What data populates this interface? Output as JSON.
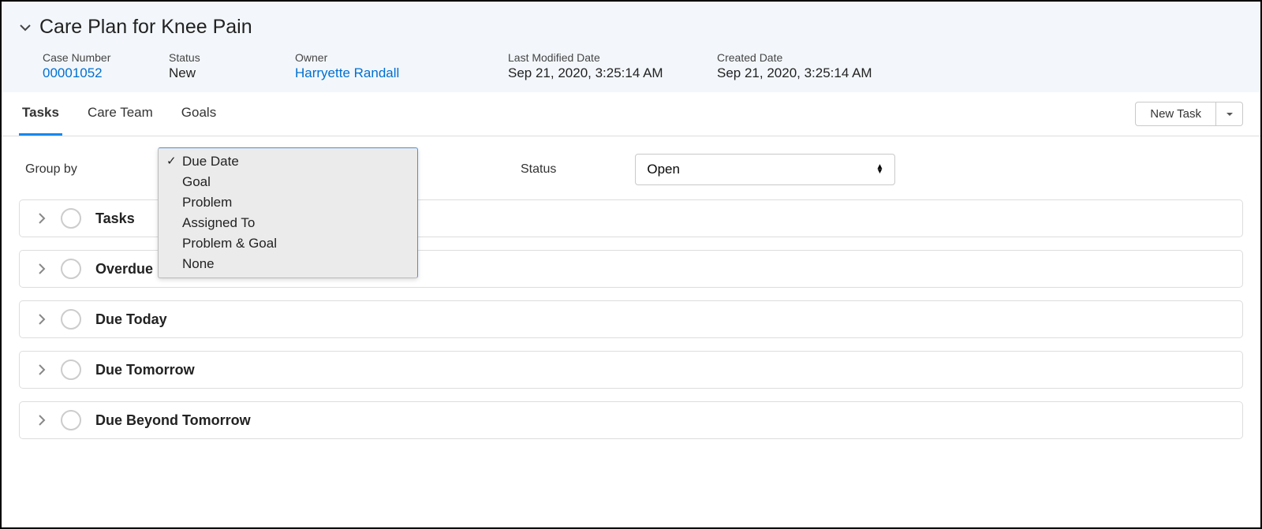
{
  "header": {
    "title": "Care Plan for Knee Pain",
    "meta": {
      "case_number": {
        "label": "Case Number",
        "value": "00001052"
      },
      "status": {
        "label": "Status",
        "value": "New"
      },
      "owner": {
        "label": "Owner",
        "value": "Harryette Randall"
      },
      "last_modified": {
        "label": "Last Modified Date",
        "value": "Sep 21, 2020, 3:25:14 AM"
      },
      "created": {
        "label": "Created Date",
        "value": "Sep 21, 2020, 3:25:14 AM"
      }
    }
  },
  "tabs": {
    "items": [
      {
        "label": "Tasks",
        "active": true
      },
      {
        "label": "Care Team",
        "active": false
      },
      {
        "label": "Goals",
        "active": false
      }
    ],
    "new_task_label": "New Task"
  },
  "filters": {
    "group_by_label": "Group by",
    "group_by_options": [
      {
        "label": "Due Date",
        "selected": true
      },
      {
        "label": "Goal",
        "selected": false
      },
      {
        "label": "Problem",
        "selected": false
      },
      {
        "label": "Assigned To",
        "selected": false
      },
      {
        "label": "Problem & Goal",
        "selected": false
      },
      {
        "label": "None",
        "selected": false
      }
    ],
    "status_label": "Status",
    "status_value": "Open"
  },
  "groups": [
    {
      "label": "Tasks"
    },
    {
      "label": "Overdue"
    },
    {
      "label": "Due Today"
    },
    {
      "label": "Due Tomorrow"
    },
    {
      "label": "Due Beyond Tomorrow"
    }
  ]
}
